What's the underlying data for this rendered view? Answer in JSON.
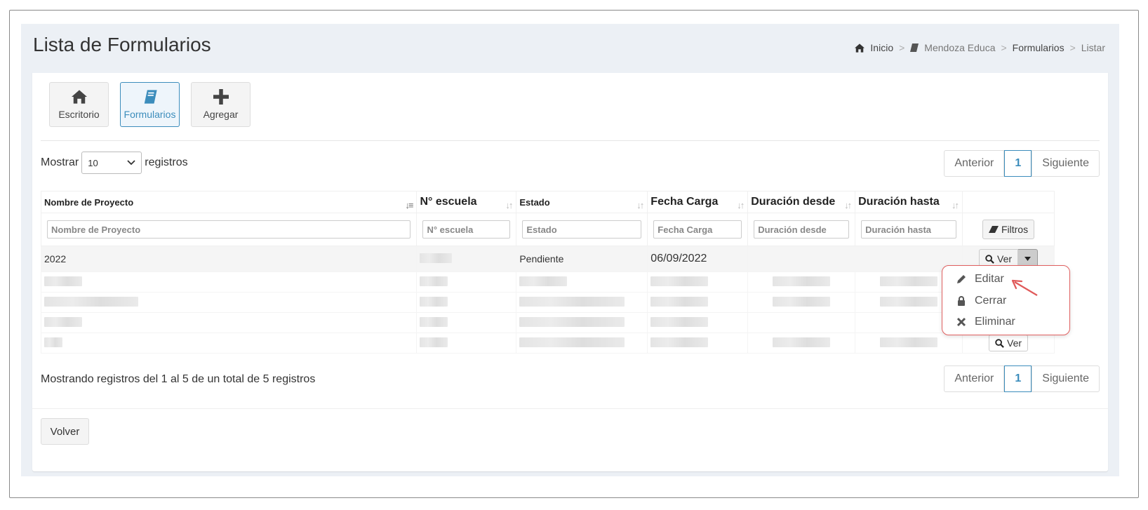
{
  "page": {
    "title": "Lista de Formularios"
  },
  "breadcrumb": [
    {
      "label": "Inicio",
      "icon": "home-icon"
    },
    {
      "label": "Mendoza Educa",
      "icon": "book-icon"
    },
    {
      "label": "Formularios"
    },
    {
      "label": "Listar"
    }
  ],
  "tiles": [
    {
      "label": "Escritorio",
      "icon": "home-icon"
    },
    {
      "label": "Formularios",
      "icon": "book-icon",
      "active": true
    },
    {
      "label": "Agregar",
      "icon": "plus-icon"
    }
  ],
  "length_menu": {
    "prefix": "Mostrar",
    "value": "10",
    "suffix": "registros"
  },
  "pagination": {
    "prev": "Anterior",
    "current": "1",
    "next": "Siguiente"
  },
  "table": {
    "columns": [
      "Nombre de Proyecto",
      "N° escuela",
      "Estado",
      "Fecha Carga",
      "Duración desde",
      "Duración hasta"
    ],
    "filters": [
      "Nombre de Proyecto",
      "N° escuela",
      "Estado",
      "Fecha Carga",
      "Duración desde",
      "Duración hasta"
    ],
    "filter_button": "Filtros",
    "first_row": {
      "nombre": "2022",
      "estado": "Pendiente",
      "fecha": "06/09/2022"
    },
    "view_label": "Ver"
  },
  "dropdown": {
    "items": [
      "Editar",
      "Cerrar",
      "Eliminar"
    ]
  },
  "info": "Mostrando registros del 1 al 5 de un total de 5 registros",
  "back_button": "Volver",
  "colors": {
    "accent": "#3c8dbc",
    "highlight_border": "#e06060"
  }
}
